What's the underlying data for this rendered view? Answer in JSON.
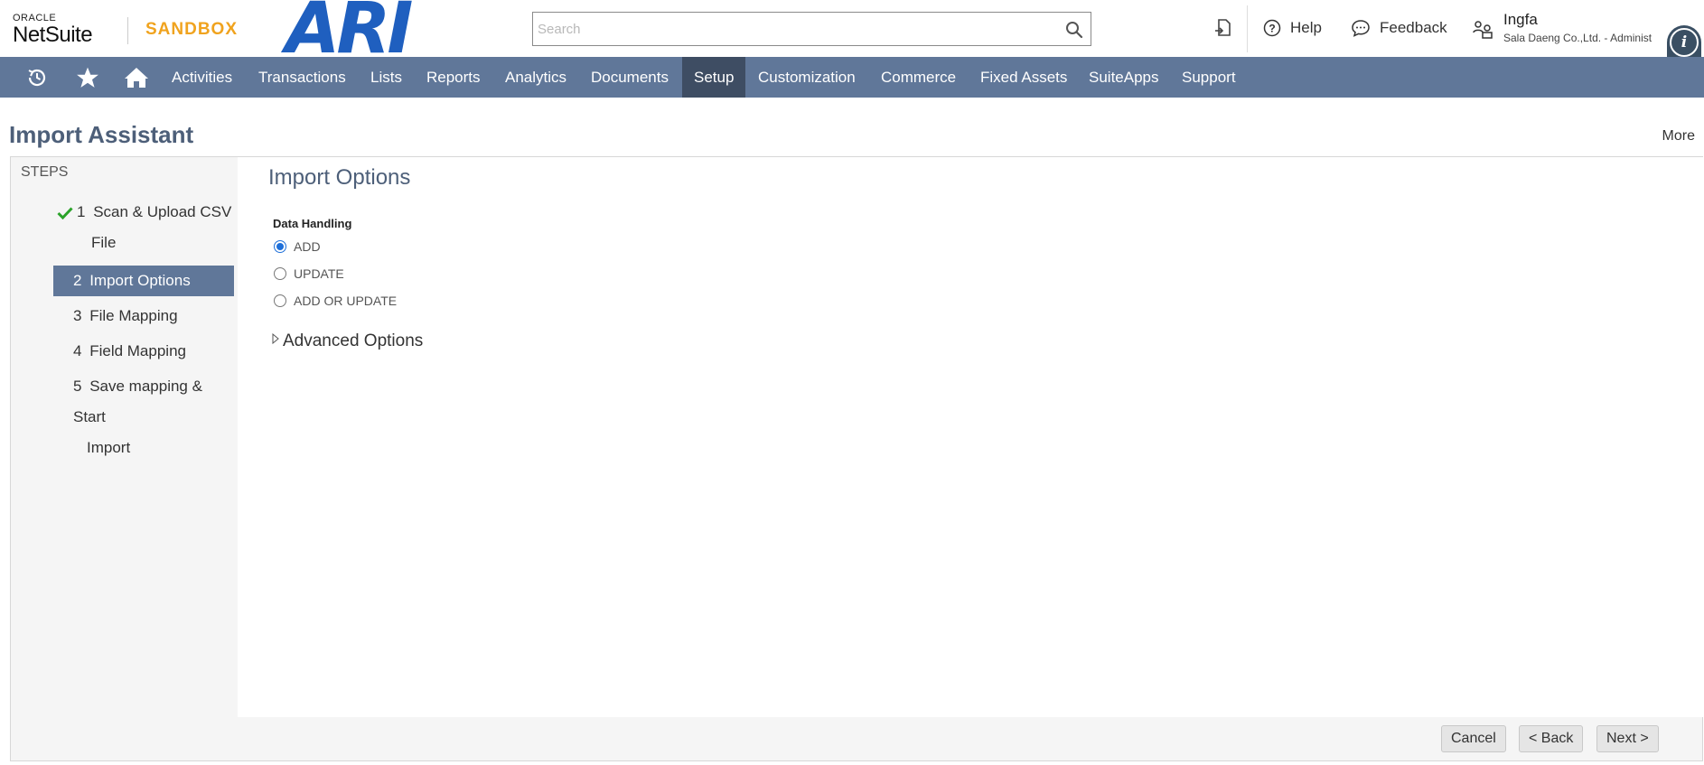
{
  "header": {
    "brand_oracle": "ORACLE",
    "brand_netsuite": "NetSuite",
    "environment": "SANDBOX",
    "company_logo_text": "ARI",
    "search_placeholder": "Search",
    "help_label": "Help",
    "feedback_label": "Feedback",
    "user_name": "Ingfa",
    "user_role": "Sala Daeng Co.,Ltd. - Administ"
  },
  "nav": {
    "items": [
      {
        "label": "Activities",
        "active": false
      },
      {
        "label": "Transactions",
        "active": false
      },
      {
        "label": "Lists",
        "active": false
      },
      {
        "label": "Reports",
        "active": false
      },
      {
        "label": "Analytics",
        "active": false
      },
      {
        "label": "Documents",
        "active": false
      },
      {
        "label": "Setup",
        "active": true
      },
      {
        "label": "Customization",
        "active": false
      },
      {
        "label": "Commerce",
        "active": false
      },
      {
        "label": "Fixed Assets",
        "active": false
      },
      {
        "label": "SuiteApps",
        "active": false
      },
      {
        "label": "Support",
        "active": false
      }
    ]
  },
  "page": {
    "title": "Import Assistant",
    "more_label": "More"
  },
  "steps": {
    "header": "STEPS",
    "items": [
      {
        "num": "1",
        "line1": "Scan & Upload CSV",
        "line2": "File",
        "done": true
      },
      {
        "num": "2",
        "line1": "Import Options",
        "active": true
      },
      {
        "num": "3",
        "line1": "File Mapping"
      },
      {
        "num": "4",
        "line1": "Field Mapping"
      },
      {
        "num": "5",
        "line1": "Save mapping & Start",
        "line2": "Import"
      }
    ]
  },
  "import_options": {
    "section_title": "Import Options",
    "data_handling_label": "Data Handling",
    "options": [
      "ADD",
      "UPDATE",
      "ADD OR UPDATE"
    ],
    "selected": "ADD",
    "advanced_label": "Advanced Options"
  },
  "buttons": {
    "cancel": "Cancel",
    "back": "< Back",
    "next": "Next >"
  },
  "colors": {
    "nav_bg": "#607799",
    "nav_active": "#3e4d63",
    "title_color": "#4d5f79",
    "sandbox": "#f0a31e",
    "radio_selected": "#1e6fd9"
  }
}
